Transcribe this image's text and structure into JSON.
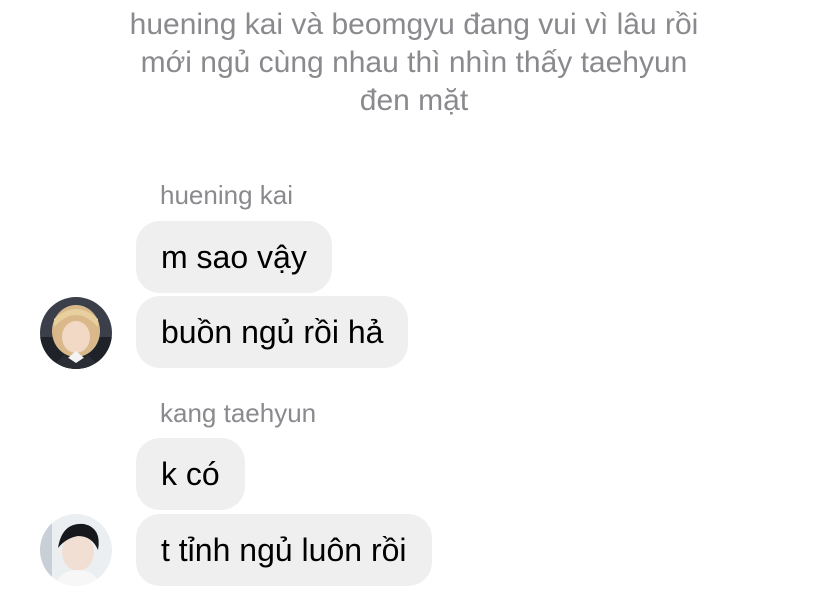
{
  "system_note": {
    "line1": "huening kai và beomgyu đang vui vì lâu rồi",
    "line2": "mới ngủ cùng nhau thì nhìn thấy taehyun",
    "line3": "đen mặt"
  },
  "messages": {
    "group1": {
      "sender": "huening kai",
      "avatar_icon": "avatar-blonde-person",
      "bubbles": [
        "m sao vậy",
        "buồn ngủ rồi hả"
      ]
    },
    "group2": {
      "sender": "kang taehyun",
      "avatar_icon": "avatar-dark-hair-person",
      "bubbles": [
        "k có",
        "t tỉnh ngủ luôn rồi"
      ]
    }
  },
  "colors": {
    "bubble_bg": "#efefef",
    "secondary_text": "#8a8a8e",
    "message_text": "#000000"
  }
}
